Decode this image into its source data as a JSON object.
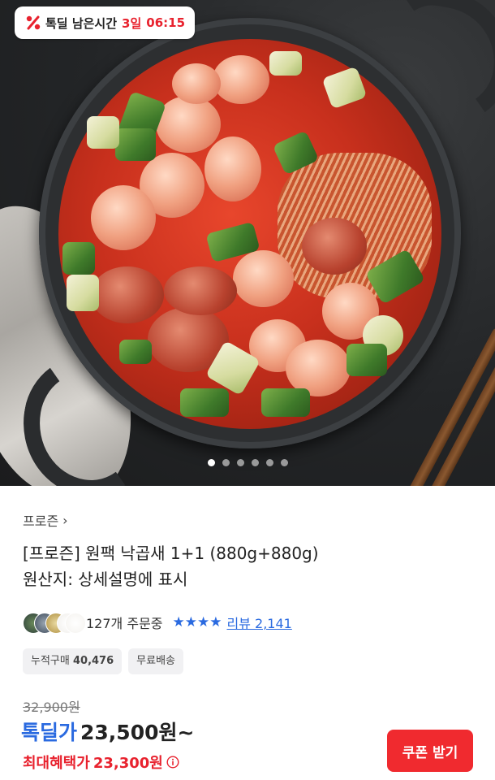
{
  "hero": {
    "timer_label": "톡딜 남은시간",
    "timer_days": "3일",
    "timer_time": "06:15",
    "carousel": {
      "total": 6,
      "active": 0
    }
  },
  "product": {
    "category": "프로즌",
    "title_line1": "[프로즌] 원팩 낙곱새 1+1 (880g+880g)",
    "title_line2": "원산지: 상세설명에 표시",
    "orders_text": "127개 주문중",
    "stars": "★★★★",
    "review_text": "리뷰 2,141",
    "badge_cumulative_label": "누적구매",
    "badge_cumulative_value": "40,476",
    "badge_shipping": "무료배송"
  },
  "price": {
    "original": "32,900원",
    "deal_label": "톡딜가",
    "deal_price": "23,500원~",
    "max_label": "최대혜택가",
    "max_price": "23,300원",
    "coupon_button": "쿠폰 받기"
  },
  "colors": {
    "accent_red": "#e8222e",
    "accent_blue": "#2a6ae0",
    "coupon_bg": "#f02a2f"
  }
}
